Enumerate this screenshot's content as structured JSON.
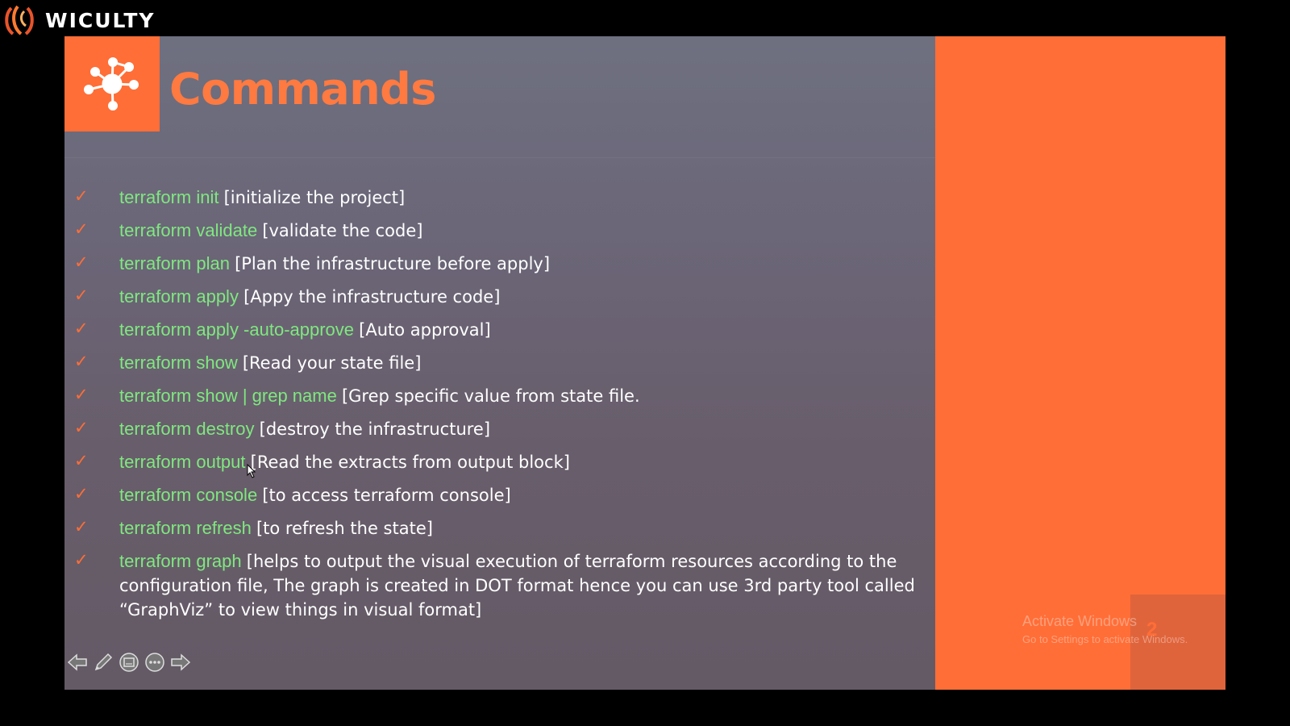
{
  "brand": {
    "name": "WICULTY"
  },
  "slide": {
    "title": "Commands",
    "number": "2",
    "commands": [
      {
        "cmd": "terraform init",
        "desc": "[initialize the project]"
      },
      {
        "cmd": "terraform validate",
        "desc": "[validate the code]"
      },
      {
        "cmd": "terraform plan",
        "desc": "[Plan the infrastructure before apply]"
      },
      {
        "cmd": "terraform apply",
        "desc": "[Appy the infrastructure code]"
      },
      {
        "cmd": "terraform apply -auto-approve",
        "desc": "[Auto approval]"
      },
      {
        "cmd": "terraform show",
        "desc": "[Read your state file]"
      },
      {
        "cmd": "terraform show | grep name",
        "desc": "[Grep specific value from state file."
      },
      {
        "cmd": "terraform destroy",
        "desc": "[destroy the infrastructure]"
      },
      {
        "cmd": "terraform output",
        "desc": "[Read the extracts from output block]"
      },
      {
        "cmd": "terraform console",
        "desc": "[to access terraform console]"
      },
      {
        "cmd": "terraform refresh",
        "desc": "[to refresh the state]"
      },
      {
        "cmd": "terraform graph",
        "desc": "[helps to output the visual execution of terraform resources according to the configuration file, The graph is created in DOT format hence you can use 3rd party tool called “GraphViz” to view things in visual format]"
      }
    ]
  },
  "watermark": {
    "title": "Activate Windows",
    "subtitle": "Go to Settings to activate Windows."
  },
  "colors": {
    "accent": "#ff6e37",
    "command": "#7fe87f",
    "slide_bg": "#6a6878"
  },
  "icons": {
    "title": "network-hub-icon",
    "bullet": "checkmark-icon",
    "nav": [
      "arrow-left-icon",
      "pen-icon",
      "slides-icon",
      "more-icon",
      "arrow-right-icon"
    ]
  }
}
